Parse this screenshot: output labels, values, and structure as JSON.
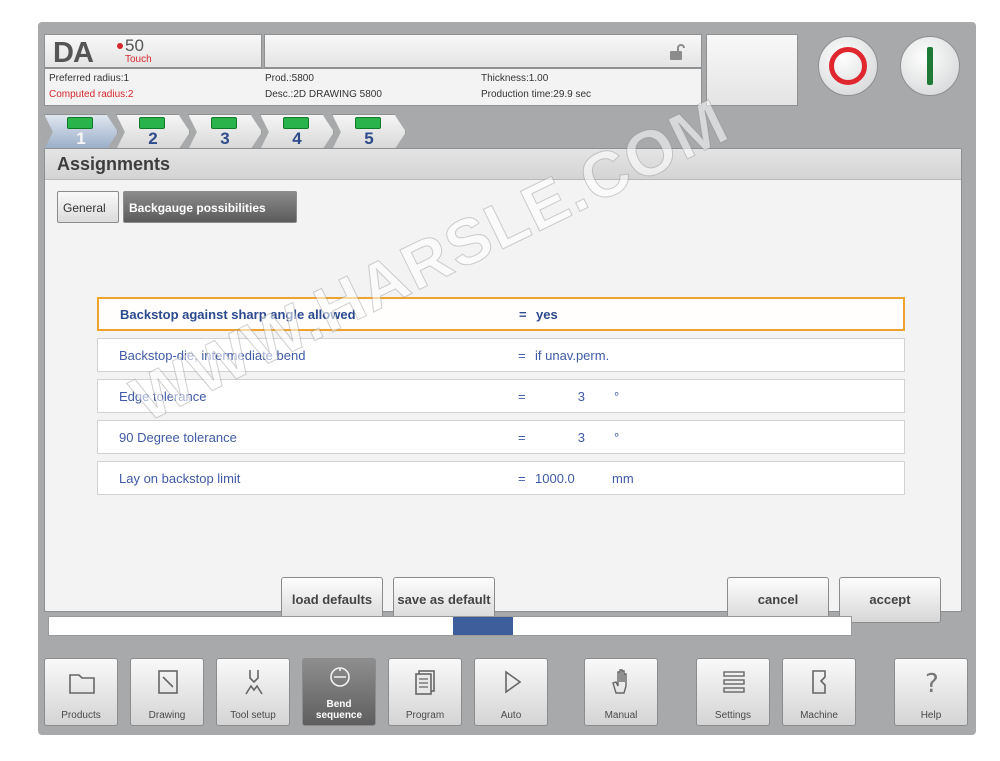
{
  "logo": {
    "brand": "DA",
    "model": "50",
    "edition": "Touch"
  },
  "header": {
    "preferred_radius": "Preferred radius:1",
    "computed_radius": "Computed radius:2",
    "product": "Prod.:5800",
    "description": "Desc.:2D DRAWING 5800",
    "thickness": "Thickness:1.00",
    "production_time": "Production time:29.9 sec"
  },
  "steps": [
    "1",
    "2",
    "3",
    "4",
    "5"
  ],
  "dialog": {
    "title": "Assignments",
    "tabs": {
      "general": "General",
      "backgauge": "Backgauge possibilities"
    },
    "params": [
      {
        "label": "Backstop against sharp angle allowed",
        "eq": "=",
        "value": "yes",
        "unit": ""
      },
      {
        "label": "Backstop-die, intermediate bend",
        "eq": "=",
        "value": "if unav.perm.",
        "unit": ""
      },
      {
        "label": "Edge tolerance",
        "eq": "=",
        "value": "3",
        "unit": "°"
      },
      {
        "label": "90 Degree tolerance",
        "eq": "=",
        "value": "3",
        "unit": "°"
      },
      {
        "label": "Lay on backstop limit",
        "eq": "=",
        "value": "1000.0",
        "unit": "mm"
      }
    ],
    "buttons": {
      "load_defaults": "load defaults",
      "save_default": "save as default",
      "cancel": "cancel",
      "accept": "accept"
    }
  },
  "nav": [
    {
      "label": "Products",
      "icon": "folder-icon"
    },
    {
      "label": "Drawing",
      "icon": "drawing-icon"
    },
    {
      "label": "Tool setup",
      "icon": "tool-icon"
    },
    {
      "label": "Bend sequence",
      "icon": "bend-sequence-icon",
      "active": true
    },
    {
      "label": "Program",
      "icon": "program-icon"
    },
    {
      "label": "Auto",
      "icon": "play-icon"
    },
    {
      "label": "Manual",
      "icon": "hand-icon"
    },
    {
      "label": "Settings",
      "icon": "settings-icon"
    },
    {
      "label": "Machine",
      "icon": "machine-icon"
    },
    {
      "label": "Help",
      "icon": "help-icon"
    }
  ],
  "watermark": "WWW.HARSLE.COM",
  "colors": {
    "accent_red": "#e0272f",
    "accent_green": "#1e7a35",
    "selection_orange": "#eda32c",
    "text_blue": "#3f5aa6"
  }
}
